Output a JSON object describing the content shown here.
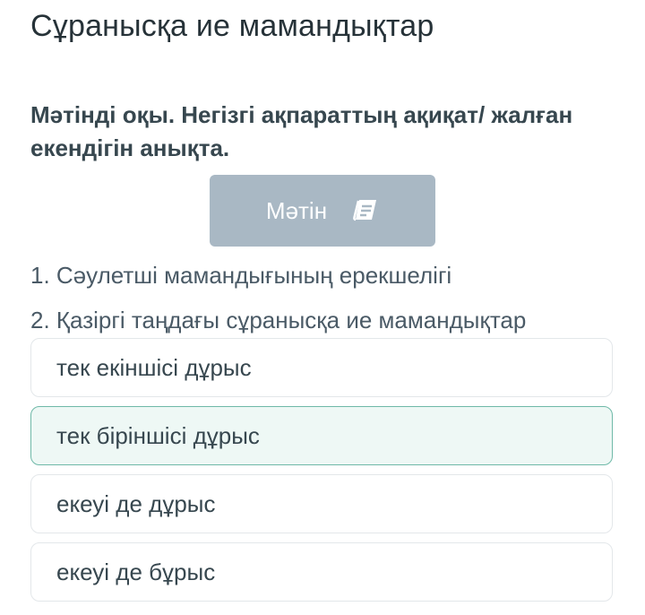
{
  "page": {
    "title": "Сұранысқа ие мамандықтар"
  },
  "question": {
    "instruction": "Мәтінді оқы. Негізгі ақпараттың ақиқат/ жалған екендігін анықта.",
    "text_button_label": "Мәтін",
    "text_button_icon": "book-icon",
    "statements": [
      "1. Сәулетші мамандығының ерекшелігі",
      "2. Қазіргі таңдағы сұранысқа ие мамандықтар"
    ]
  },
  "options": [
    {
      "label": "тек екіншісі дұрыс",
      "selected": false
    },
    {
      "label": "тек біріншісі дұрыс",
      "selected": true
    },
    {
      "label": "екеуі де дұрыс",
      "selected": false
    },
    {
      "label": "екеуі де бұрыс",
      "selected": false
    }
  ],
  "colors": {
    "button_bg": "#a9b8c4",
    "selected_border": "#6fb9a8",
    "selected_bg": "#eef8f5"
  }
}
